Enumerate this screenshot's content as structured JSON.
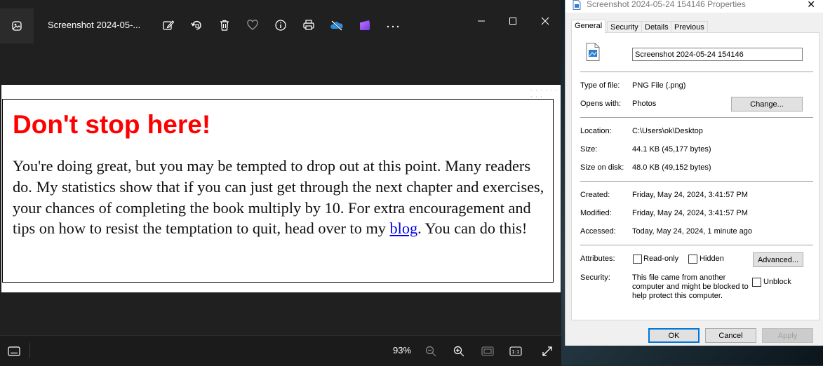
{
  "photos": {
    "title": "Screenshot 2024-05-...",
    "toolbar": [
      "edit-icon",
      "rotate-icon",
      "delete-icon",
      "favorite-icon",
      "info-icon",
      "print-icon",
      "onedrive-icon",
      "clipchamp-icon",
      "more-icon"
    ],
    "image": {
      "heading": "Don't stop here!",
      "body_before": "You're doing great, but you may be tempted to drop out at this point. Many readers do. My statistics show that if you can just get through the next chapter and exercises, your chances of completing the book multiply by 10. For extra encouragement and tips on how to resist the temptation to quit, head over to my ",
      "link": "blog",
      "body_after": ". You can do this!"
    },
    "footer": {
      "zoom": "93%"
    }
  },
  "props": {
    "title": "Screenshot 2024-05-24 154146 Properties",
    "tabs": [
      "General",
      "Security",
      "Details",
      "Previous Versions"
    ],
    "filename": "Screenshot 2024-05-24 154146",
    "labels": {
      "type": "Type of file:",
      "opens": "Opens with:",
      "location": "Location:",
      "size": "Size:",
      "size_on_disk": "Size on disk:",
      "created": "Created:",
      "modified": "Modified:",
      "accessed": "Accessed:",
      "attributes": "Attributes:",
      "security": "Security:"
    },
    "values": {
      "type": "PNG File (.png)",
      "opens": "Photos",
      "location": "C:\\Users\\ok\\Desktop",
      "size": "44.1 KB (45,177 bytes)",
      "size_on_disk": "48.0 KB (49,152 bytes)",
      "created": "Friday, May 24, 2024, 3:41:57 PM",
      "modified": "Friday, May 24, 2024, 3:41:57 PM",
      "accessed": "Today, May 24, 2024, 1 minute ago",
      "security_text": "This file came from another computer and might be blocked to help protect this computer."
    },
    "buttons": {
      "change": "Change...",
      "advanced": "Advanced...",
      "ok": "OK",
      "cancel": "Cancel",
      "apply": "Apply"
    },
    "checks": {
      "readonly": "Read-only",
      "hidden": "Hidden",
      "unblock": "Unblock"
    }
  }
}
